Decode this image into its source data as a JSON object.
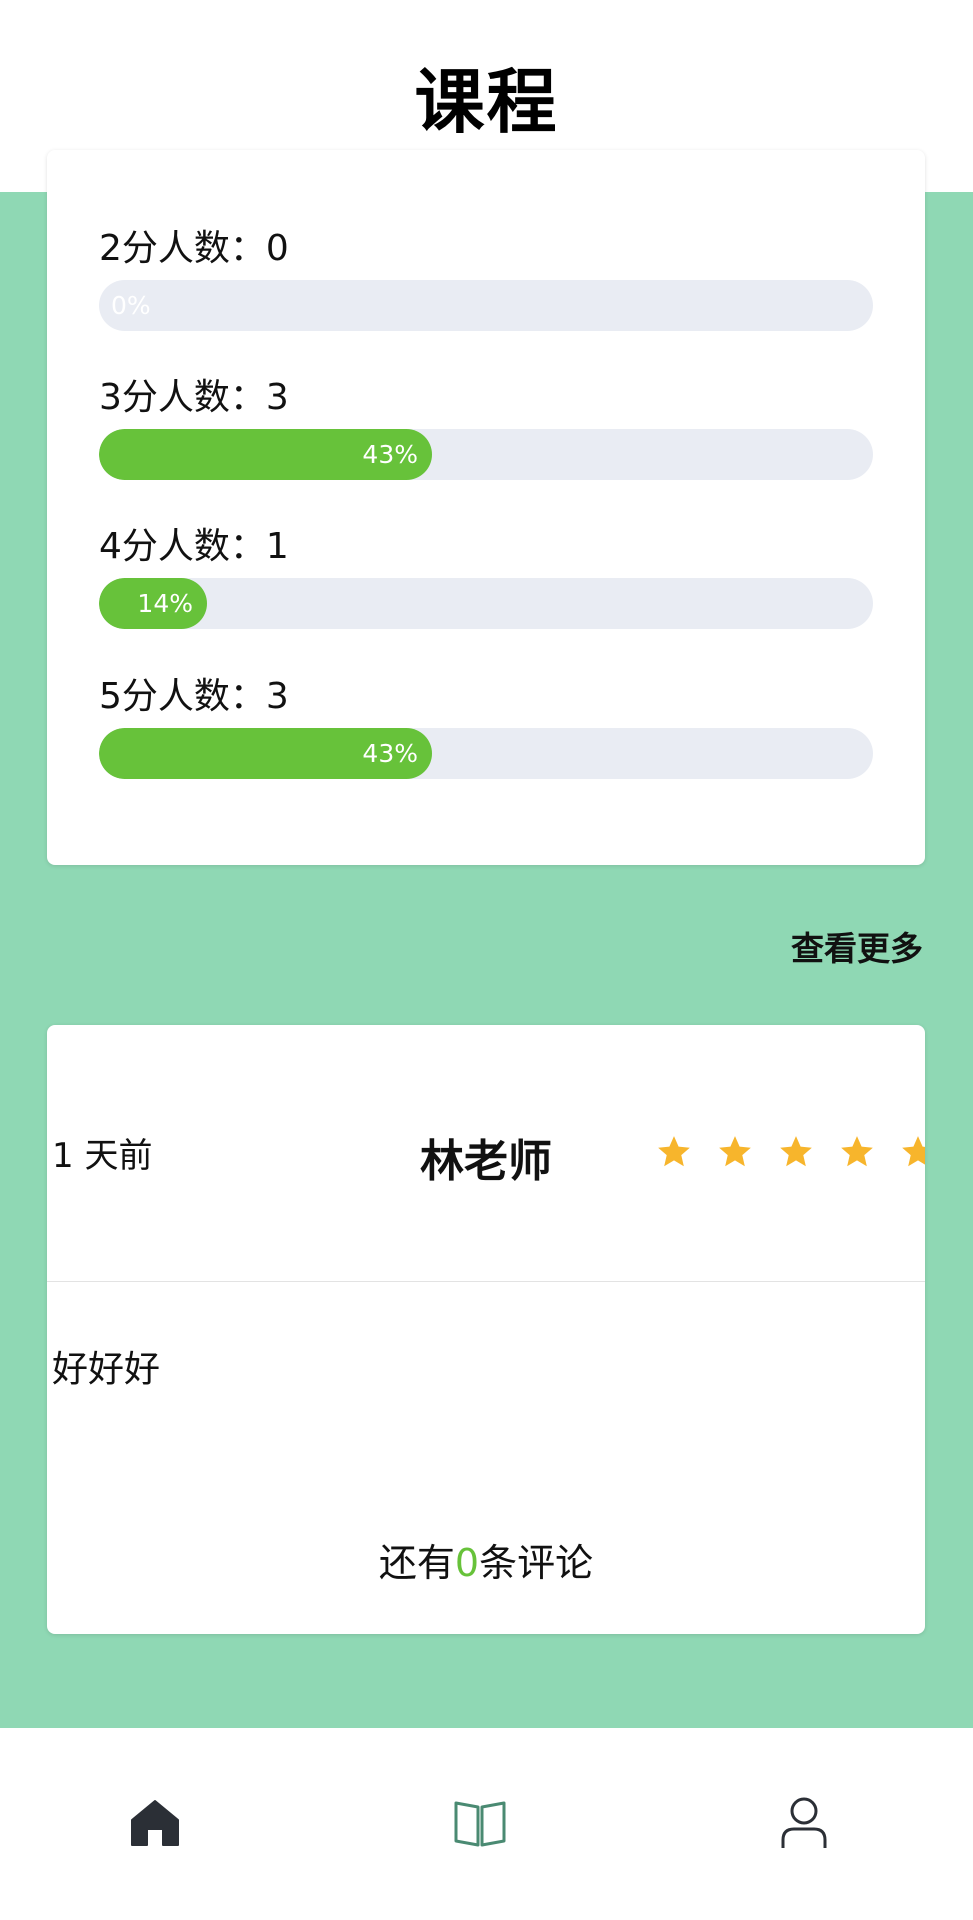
{
  "header": {
    "title": "课程"
  },
  "ratings": [
    {
      "label": "2分人数：0",
      "percent_label": "0%",
      "fraction": 0.0
    },
    {
      "label": "3分人数：3",
      "percent_label": "43%",
      "fraction": 0.43
    },
    {
      "label": "4分人数：1",
      "percent_label": "14%",
      "fraction": 0.14
    },
    {
      "label": "5分人数：3",
      "percent_label": "43%",
      "fraction": 0.43
    }
  ],
  "view_more": "查看更多",
  "comment": {
    "time": "1 天前",
    "author": "林老师",
    "stars": 5,
    "body": "好好好",
    "more_prefix": "还有",
    "more_count": "0",
    "more_suffix": "条评论"
  },
  "colors": {
    "background": "#8fd8b4",
    "accent_green": "#67c23a",
    "track": "#e9ecf3",
    "star": "#f7b52c",
    "nav_active": "#4a8a72",
    "nav_inactive": "#2b2f36"
  },
  "nav": [
    {
      "icon": "home-icon",
      "active": false
    },
    {
      "icon": "book-icon",
      "active": true
    },
    {
      "icon": "user-icon",
      "active": false
    }
  ]
}
